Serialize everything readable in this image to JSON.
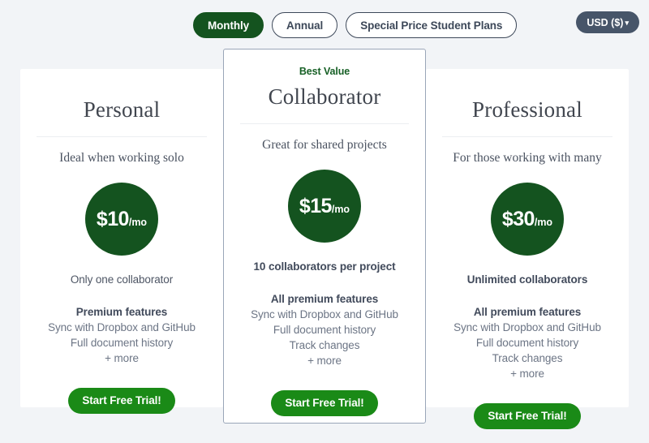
{
  "billing_toggle": {
    "options": [
      {
        "label": "Monthly",
        "selected": true
      },
      {
        "label": "Annual",
        "selected": false
      },
      {
        "label": "Special Price Student Plans",
        "selected": false
      }
    ]
  },
  "currency_selector": {
    "label": "USD ($)",
    "caret": "▾"
  },
  "colors": {
    "page_background": "#f2f4f7",
    "dark_green": "#14531f",
    "cta_green": "#1a8a17",
    "best_value_green": "#176026",
    "currency_slate": "#475569",
    "featured_border": "#9aa6b8"
  },
  "plans": [
    {
      "badge": "",
      "name": "Personal",
      "tagline": "Ideal when working solo",
      "price_amount": "$10",
      "price_period": "/mo",
      "collaborators": "Only one collaborator",
      "collaborators_bold": false,
      "features_head": "Premium features",
      "features": [
        "Sync with Dropbox and GitHub",
        "Full document history",
        "+ more"
      ],
      "cta": "Start Free Trial!"
    },
    {
      "badge": "Best Value",
      "name": "Collaborator",
      "tagline": "Great for shared projects",
      "price_amount": "$15",
      "price_period": "/mo",
      "collaborators": "10 collaborators per project",
      "collaborators_bold": true,
      "features_head": "All premium features",
      "features": [
        "Sync with Dropbox and GitHub",
        "Full document history",
        "Track changes",
        "+ more"
      ],
      "cta": "Start Free Trial!"
    },
    {
      "badge": "",
      "name": "Professional",
      "tagline": "For those working with many",
      "price_amount": "$30",
      "price_period": "/mo",
      "collaborators": "Unlimited collaborators",
      "collaborators_bold": true,
      "features_head": "All premium features",
      "features": [
        "Sync with Dropbox and GitHub",
        "Full document history",
        "Track changes",
        "+ more"
      ],
      "cta": "Start Free Trial!"
    }
  ]
}
